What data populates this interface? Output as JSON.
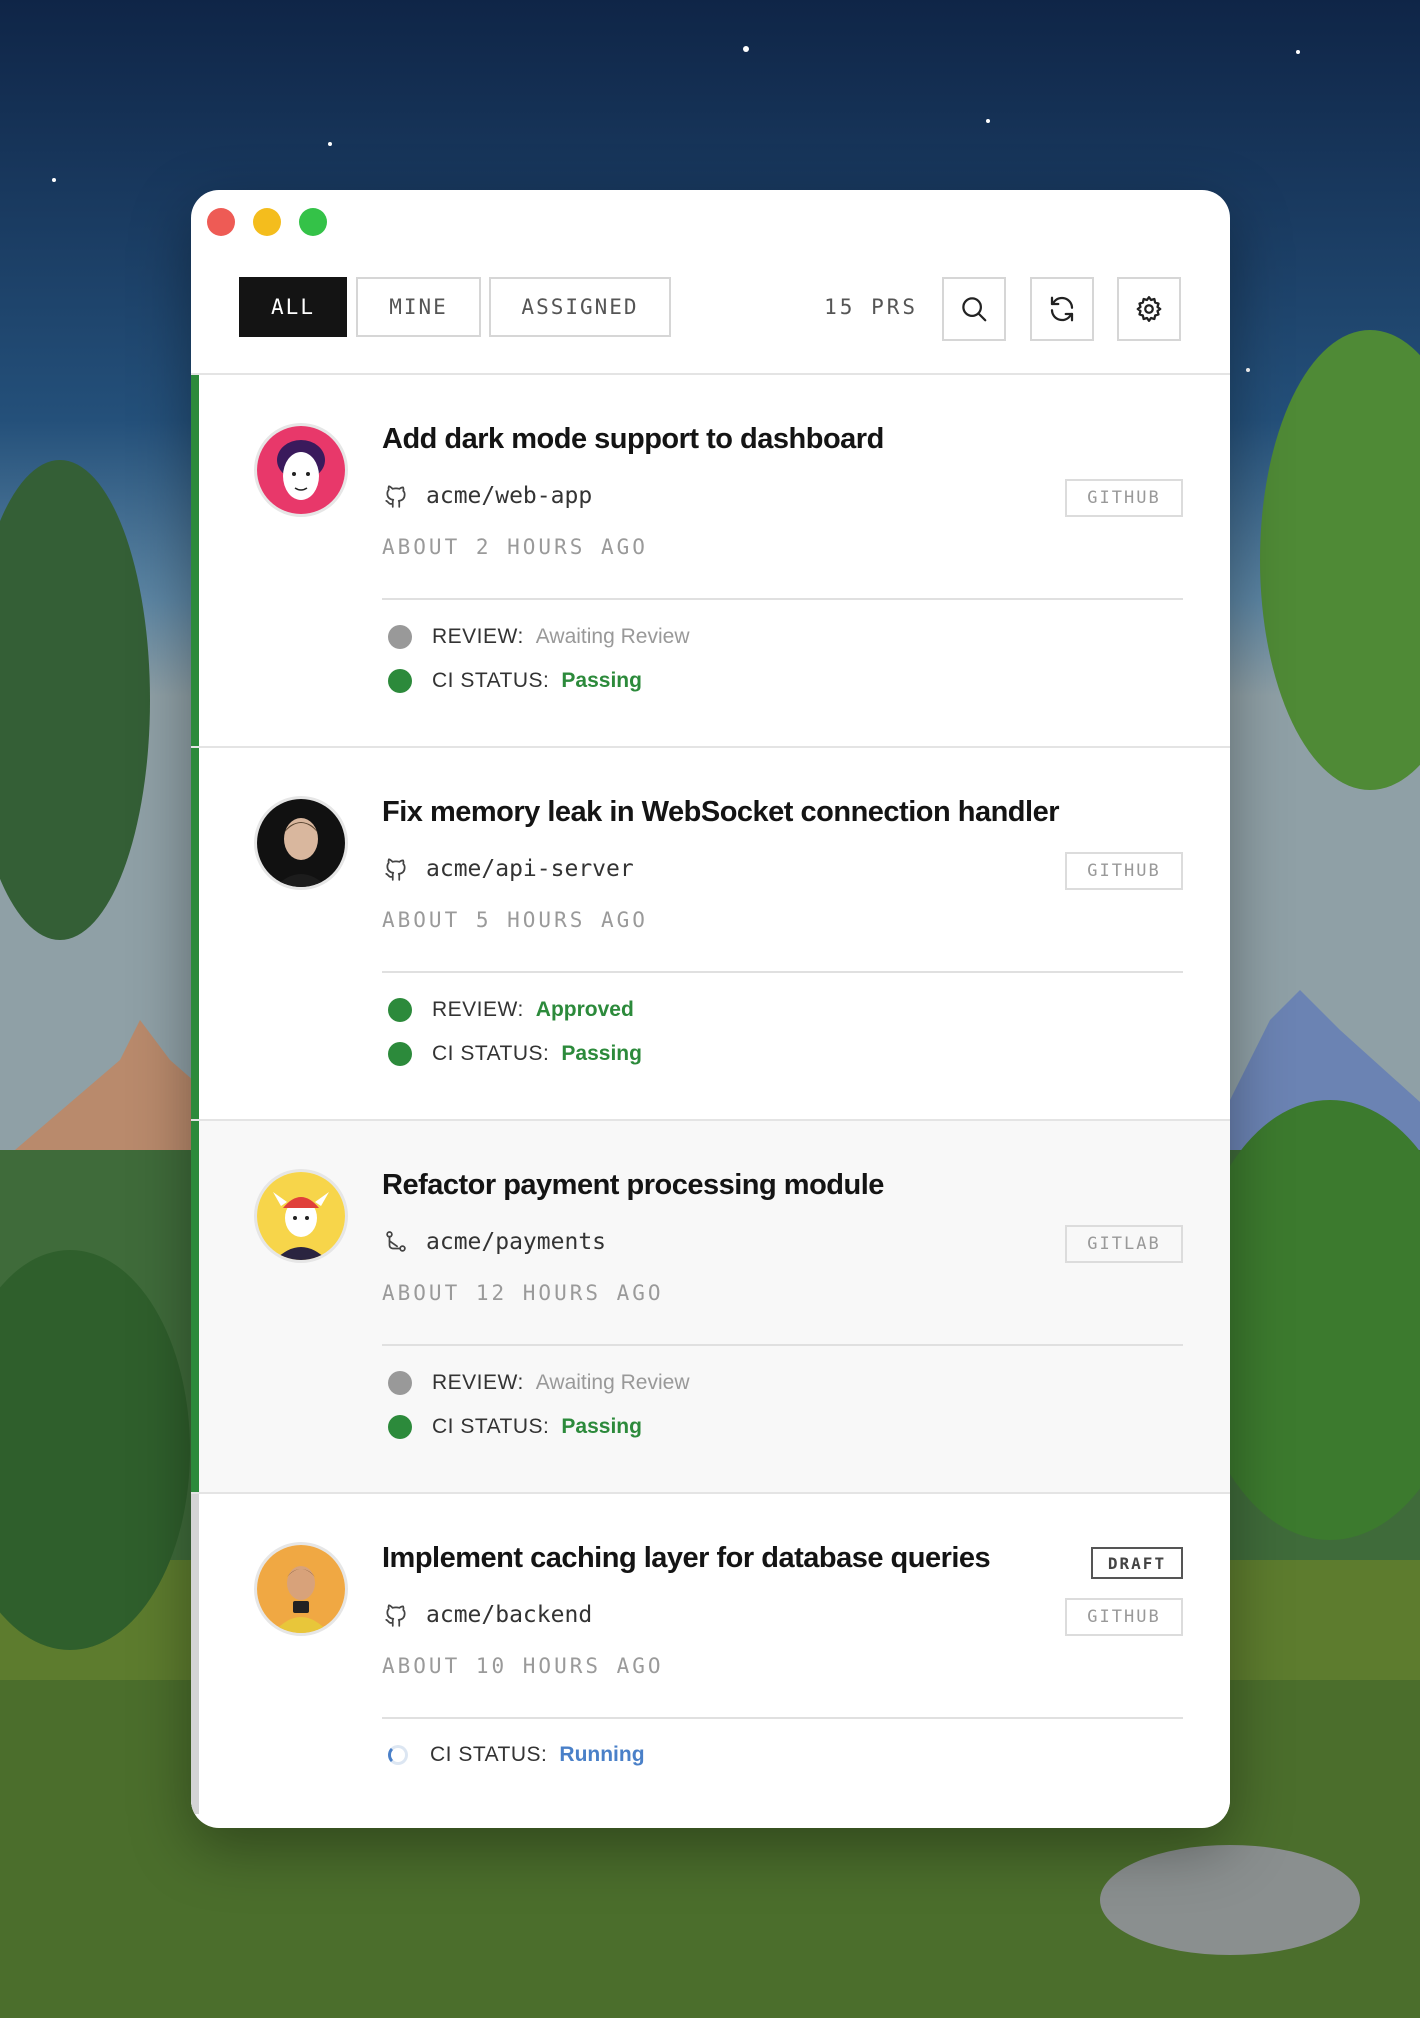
{
  "toolbar": {
    "tabs": [
      {
        "label": "ALL",
        "active": true
      },
      {
        "label": "MINE",
        "active": false
      },
      {
        "label": "ASSIGNED",
        "active": false
      }
    ],
    "pr_count": "15 PRS",
    "buttons": [
      "search-icon",
      "refresh-icon",
      "gear-icon"
    ]
  },
  "colors": {
    "accent_green": "#2c8a3b",
    "running_blue": "#4a80c8",
    "muted_grey": "#999999",
    "active_tab_bg": "#141414"
  },
  "pull_requests": [
    {
      "title": "Add dark mode support to dashboard",
      "repo": "acme/web-app",
      "repo_icon": "github-icon",
      "platform": "GITHUB",
      "time_ago": "ABOUT 2 HOURS AGO",
      "review_label": "REVIEW:",
      "review_value": "Awaiting Review",
      "ci_label": "CI STATUS:",
      "ci_value": "Passing"
    },
    {
      "title": "Fix memory leak in WebSocket connection handler",
      "repo": "acme/api-server",
      "repo_icon": "github-icon",
      "platform": "GITHUB",
      "time_ago": "ABOUT 5 HOURS AGO",
      "review_label": "REVIEW:",
      "review_value": "Approved",
      "ci_label": "CI STATUS:",
      "ci_value": "Passing"
    },
    {
      "title": "Refactor payment processing module",
      "repo": "acme/payments",
      "repo_icon": "merge-request-icon",
      "platform": "GITLAB",
      "time_ago": "ABOUT 12 HOURS AGO",
      "review_label": "REVIEW:",
      "review_value": "Awaiting Review",
      "ci_label": "CI STATUS:",
      "ci_value": "Passing"
    },
    {
      "title": "Implement caching layer for database queries",
      "draft": "DRAFT",
      "repo": "acme/backend",
      "repo_icon": "github-icon",
      "platform": "GITHUB",
      "time_ago": "ABOUT 10 HOURS AGO",
      "ci_label": "CI STATUS:",
      "ci_value": "Running"
    }
  ]
}
